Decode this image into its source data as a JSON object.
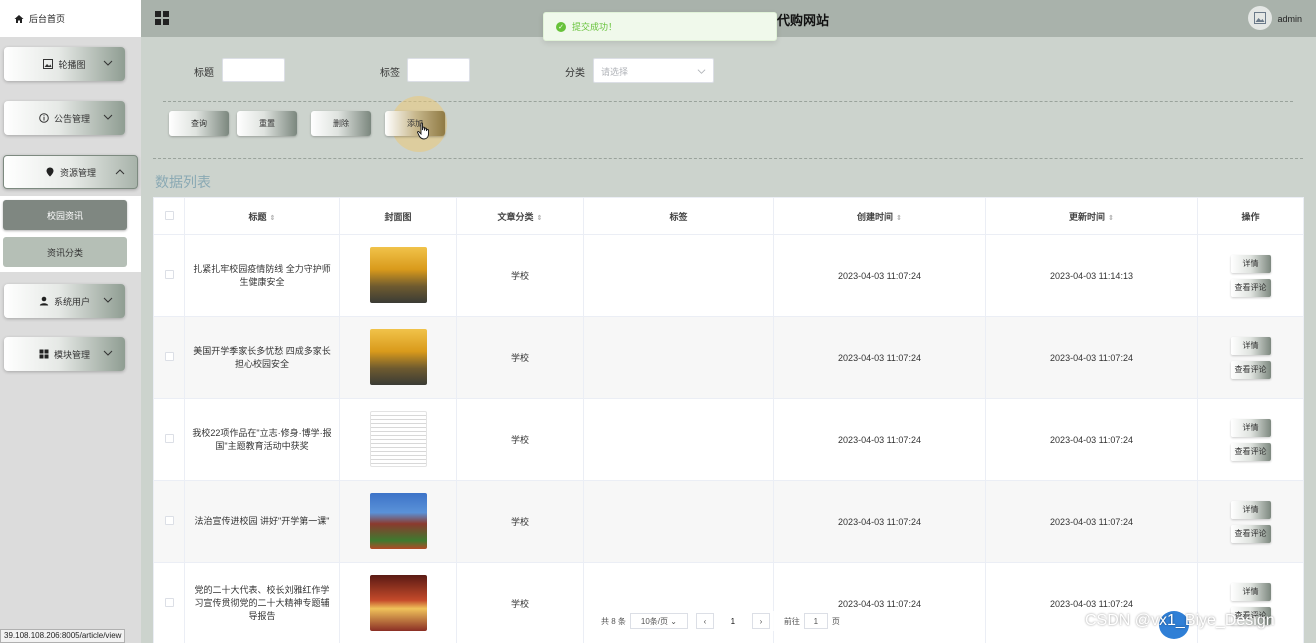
{
  "sidebar": {
    "home_label": "后台首页",
    "menus": [
      {
        "label": "轮播图",
        "icon": "image-icon"
      },
      {
        "label": "公告管理",
        "icon": "info-circle-icon"
      },
      {
        "label": "资源管理",
        "icon": "pin-icon",
        "open": true
      },
      {
        "label": "系统用户",
        "icon": "user-icon"
      },
      {
        "label": "模块管理",
        "icon": "grid-icon"
      }
    ],
    "submenu": [
      {
        "label": "校园资讯",
        "active": true
      },
      {
        "label": "资讯分类",
        "active": false
      }
    ]
  },
  "status_url": "39.108.108.206:8005/article/view",
  "header": {
    "title": "代购网站",
    "user": "admin"
  },
  "toast": {
    "message": "提交成功！"
  },
  "filters": {
    "title_label": "标题",
    "tag_label": "标签",
    "category_label": "分类",
    "category_placeholder": "请选择"
  },
  "actions": {
    "query": "查询",
    "reset": "重置",
    "delete": "删除",
    "add": "添加"
  },
  "list_title": "数据列表",
  "table": {
    "headers": {
      "title": "标题",
      "cover": "封面图",
      "category": "文章分类",
      "tag": "标签",
      "created": "创建时间",
      "updated": "更新时间",
      "ops": "操作"
    },
    "detail_label": "详情",
    "comment_label": "查看评论",
    "rows": [
      {
        "title": "扎紧扎牢校园疫情防线 全力守护师生健康安全",
        "cover": "tree",
        "category": "学校",
        "tag": "",
        "created": "2023-04-03 11:07:24",
        "updated": "2023-04-03 11:14:13"
      },
      {
        "title": "美国开学季家长多忧愁 四成多家长担心校园安全",
        "cover": "tree",
        "category": "学校",
        "tag": "",
        "created": "2023-04-03 11:07:24",
        "updated": "2023-04-03 11:07:24"
      },
      {
        "title": "我校22项作品在\"立志·修身·博学·报国\"主题教育活动中获奖",
        "cover": "doc",
        "category": "学校",
        "tag": "",
        "created": "2023-04-03 11:07:24",
        "updated": "2023-04-03 11:07:24"
      },
      {
        "title": "法治宣传进校园 讲好\"开学第一课\"",
        "cover": "build",
        "category": "学校",
        "tag": "",
        "created": "2023-04-03 11:07:24",
        "updated": "2023-04-03 11:07:24"
      },
      {
        "title": "党的二十大代表、校长刘雅红作学习宣传贯彻党的二十大精神专题辅导报告",
        "cover": "hall",
        "category": "学校",
        "tag": "",
        "created": "2023-04-03 11:07:24",
        "updated": "2023-04-03 11:07:24"
      }
    ]
  },
  "pagination": {
    "total": "共 8 条",
    "page_size": "10条/页",
    "current": "1",
    "goto_label": "前往",
    "goto_value": "1",
    "page_suffix": "页"
  },
  "watermark": "CSDN @vx1_Biye_Design"
}
